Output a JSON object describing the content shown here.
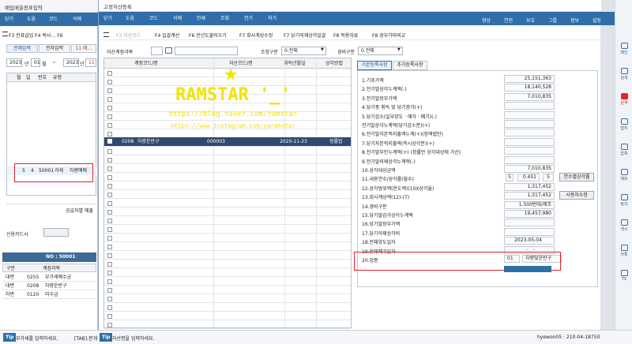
{
  "back_window": {
    "title": "매입매출전표입력",
    "toolbar": [
      "닫기",
      "도움",
      "코드",
      "삭제"
    ],
    "menu": "F3 전표삽입  F4 복사…  F6",
    "tabs": [
      "전체입력",
      "전자입력",
      "11.매…"
    ],
    "year": "2023",
    "year_unit": "년",
    "month": "01",
    "month_unit": "월",
    "tilde": "~",
    "year2": "2023",
    "year2_unit": "년",
    "month2": "11",
    "grid_headers": [
      "월",
      "일",
      "번호",
      "유형"
    ],
    "selected_row": {
      "m": "5",
      "d": "4",
      "no": "50001",
      "type": "과세",
      "desc": "차량매매"
    },
    "supplier_label": "공급처별 매출",
    "credit_label": "신용카드사",
    "no_label": "NO : 50001",
    "entries_headers": [
      "구분",
      "계정과목"
    ],
    "entries": [
      [
        "대변",
        "0255",
        "부가세예수금"
      ],
      [
        "대변",
        "0208",
        "차량운반구"
      ],
      [
        "차변",
        "0120",
        "미수금"
      ]
    ],
    "tip": "부가세를 입력하세요.",
    "tip2": "[TAB]:분개"
  },
  "main_window": {
    "title": "고정자산등록",
    "toolbar": [
      "닫기",
      "도움",
      "코드",
      "삭제",
      "인쇄",
      "조회",
      "전기",
      "처기"
    ],
    "menu": [
      "F3 자산코드",
      "F4 일괄계산",
      "F6 전년도불러오기",
      "F7 회사계상수정",
      "F7 당기의채상각일괄",
      "F8 적용자료",
      "F8 경부가마비교"
    ],
    "asset_account_label": "자산계정과목",
    "adjust_label": "조정구분",
    "adjust_value": "0.전체",
    "expense_label": "경비구분",
    "expense_value": "0.전체",
    "grid_headers": [
      "계정코드/명",
      "자산코드/명",
      "취득년월일",
      "상각방법"
    ],
    "selected_row": {
      "code": "0208",
      "name": "차량운반구",
      "asset_code": "000003",
      "date": "2020-11-23",
      "method": "정률법"
    },
    "tabs": [
      "기본등록사항",
      "추가등록사항"
    ],
    "fields": [
      {
        "label": "1.기초가액",
        "value": "25,151,363"
      },
      {
        "label": "2.전기말상각누계액(-)",
        "value": "18,140,528"
      },
      {
        "label": "3.전기말장부가액",
        "value": "7,010,835"
      },
      {
        "label": "4.당기중 취득 및 당기증가(+)",
        "value": ""
      },
      {
        "label": "5.당기감소(일부양도 · 매각 · 폐기)(-)",
        "value": ""
      },
      {
        "label": "전기말상각누계액(당기감소분)(+)",
        "value": ""
      },
      {
        "label": "6.전기말자본적지출액누계(+)(정액법만)",
        "value": ""
      },
      {
        "label": "7.당기자본적지출액(즉시상각분)(+)",
        "value": ""
      },
      {
        "label": "8.전기말부인누계액(+) (정률만 상각대상에 가산)",
        "value": ""
      },
      {
        "label": "9.전기말의제상각누계액(-)",
        "value": ""
      },
      {
        "label": "10.상각대상금액",
        "value": "7,010,835"
      },
      {
        "label": "11.내용연수/상각률(월수)",
        "value": "0.451"
      },
      {
        "label": "12.상각범위액(한도액)(10X상각율)",
        "value": "1,317,452"
      },
      {
        "label": "13.회사계상액(12)-(7)",
        "value": "1,317,452"
      },
      {
        "label": "14.경비구분",
        "value": "1.500번대/제조"
      },
      {
        "label": "15.당기말감가상각누계액",
        "value": "19,457,980"
      },
      {
        "label": "16.당기말장부가액",
        "value": ""
      },
      {
        "label": "17.당기의제상각비",
        "value": ""
      },
      {
        "label": "18.전체양도일자",
        "value": "2023-05-04"
      },
      {
        "label": "19.전체폐기일자",
        "value": "____-__-__"
      },
      {
        "label": "20.업종",
        "value": "01"
      }
    ],
    "life_years": "5",
    "life_months": "5",
    "btn_life": "연수별상각률",
    "btn_user": "사용자수정",
    "industry_name": "차량및운반구",
    "tip": "자산명을 입력하세요."
  },
  "top_right": [
    "영상",
    "연전",
    "보호",
    "그룹",
    "정보",
    "설정"
  ],
  "sidebar": [
    "메인",
    "검색",
    "원격",
    "접지",
    "압축",
    "메모",
    "링크",
    "게시",
    "카톡",
    "TV"
  ],
  "status_user": "hyewon05 : 210-04-18750",
  "watermark": {
    "brand": "RAMSTAR '_'",
    "line1": "https://blog.naver.com/ramstar",
    "line2": "https://www.instagram.com/yeramstar"
  },
  "colors": {
    "toolbar": "#2f6ea8",
    "selected_row": "#2f4a6e",
    "highlight_box": "#e0242a",
    "tab_active": "#e8f1fb"
  }
}
